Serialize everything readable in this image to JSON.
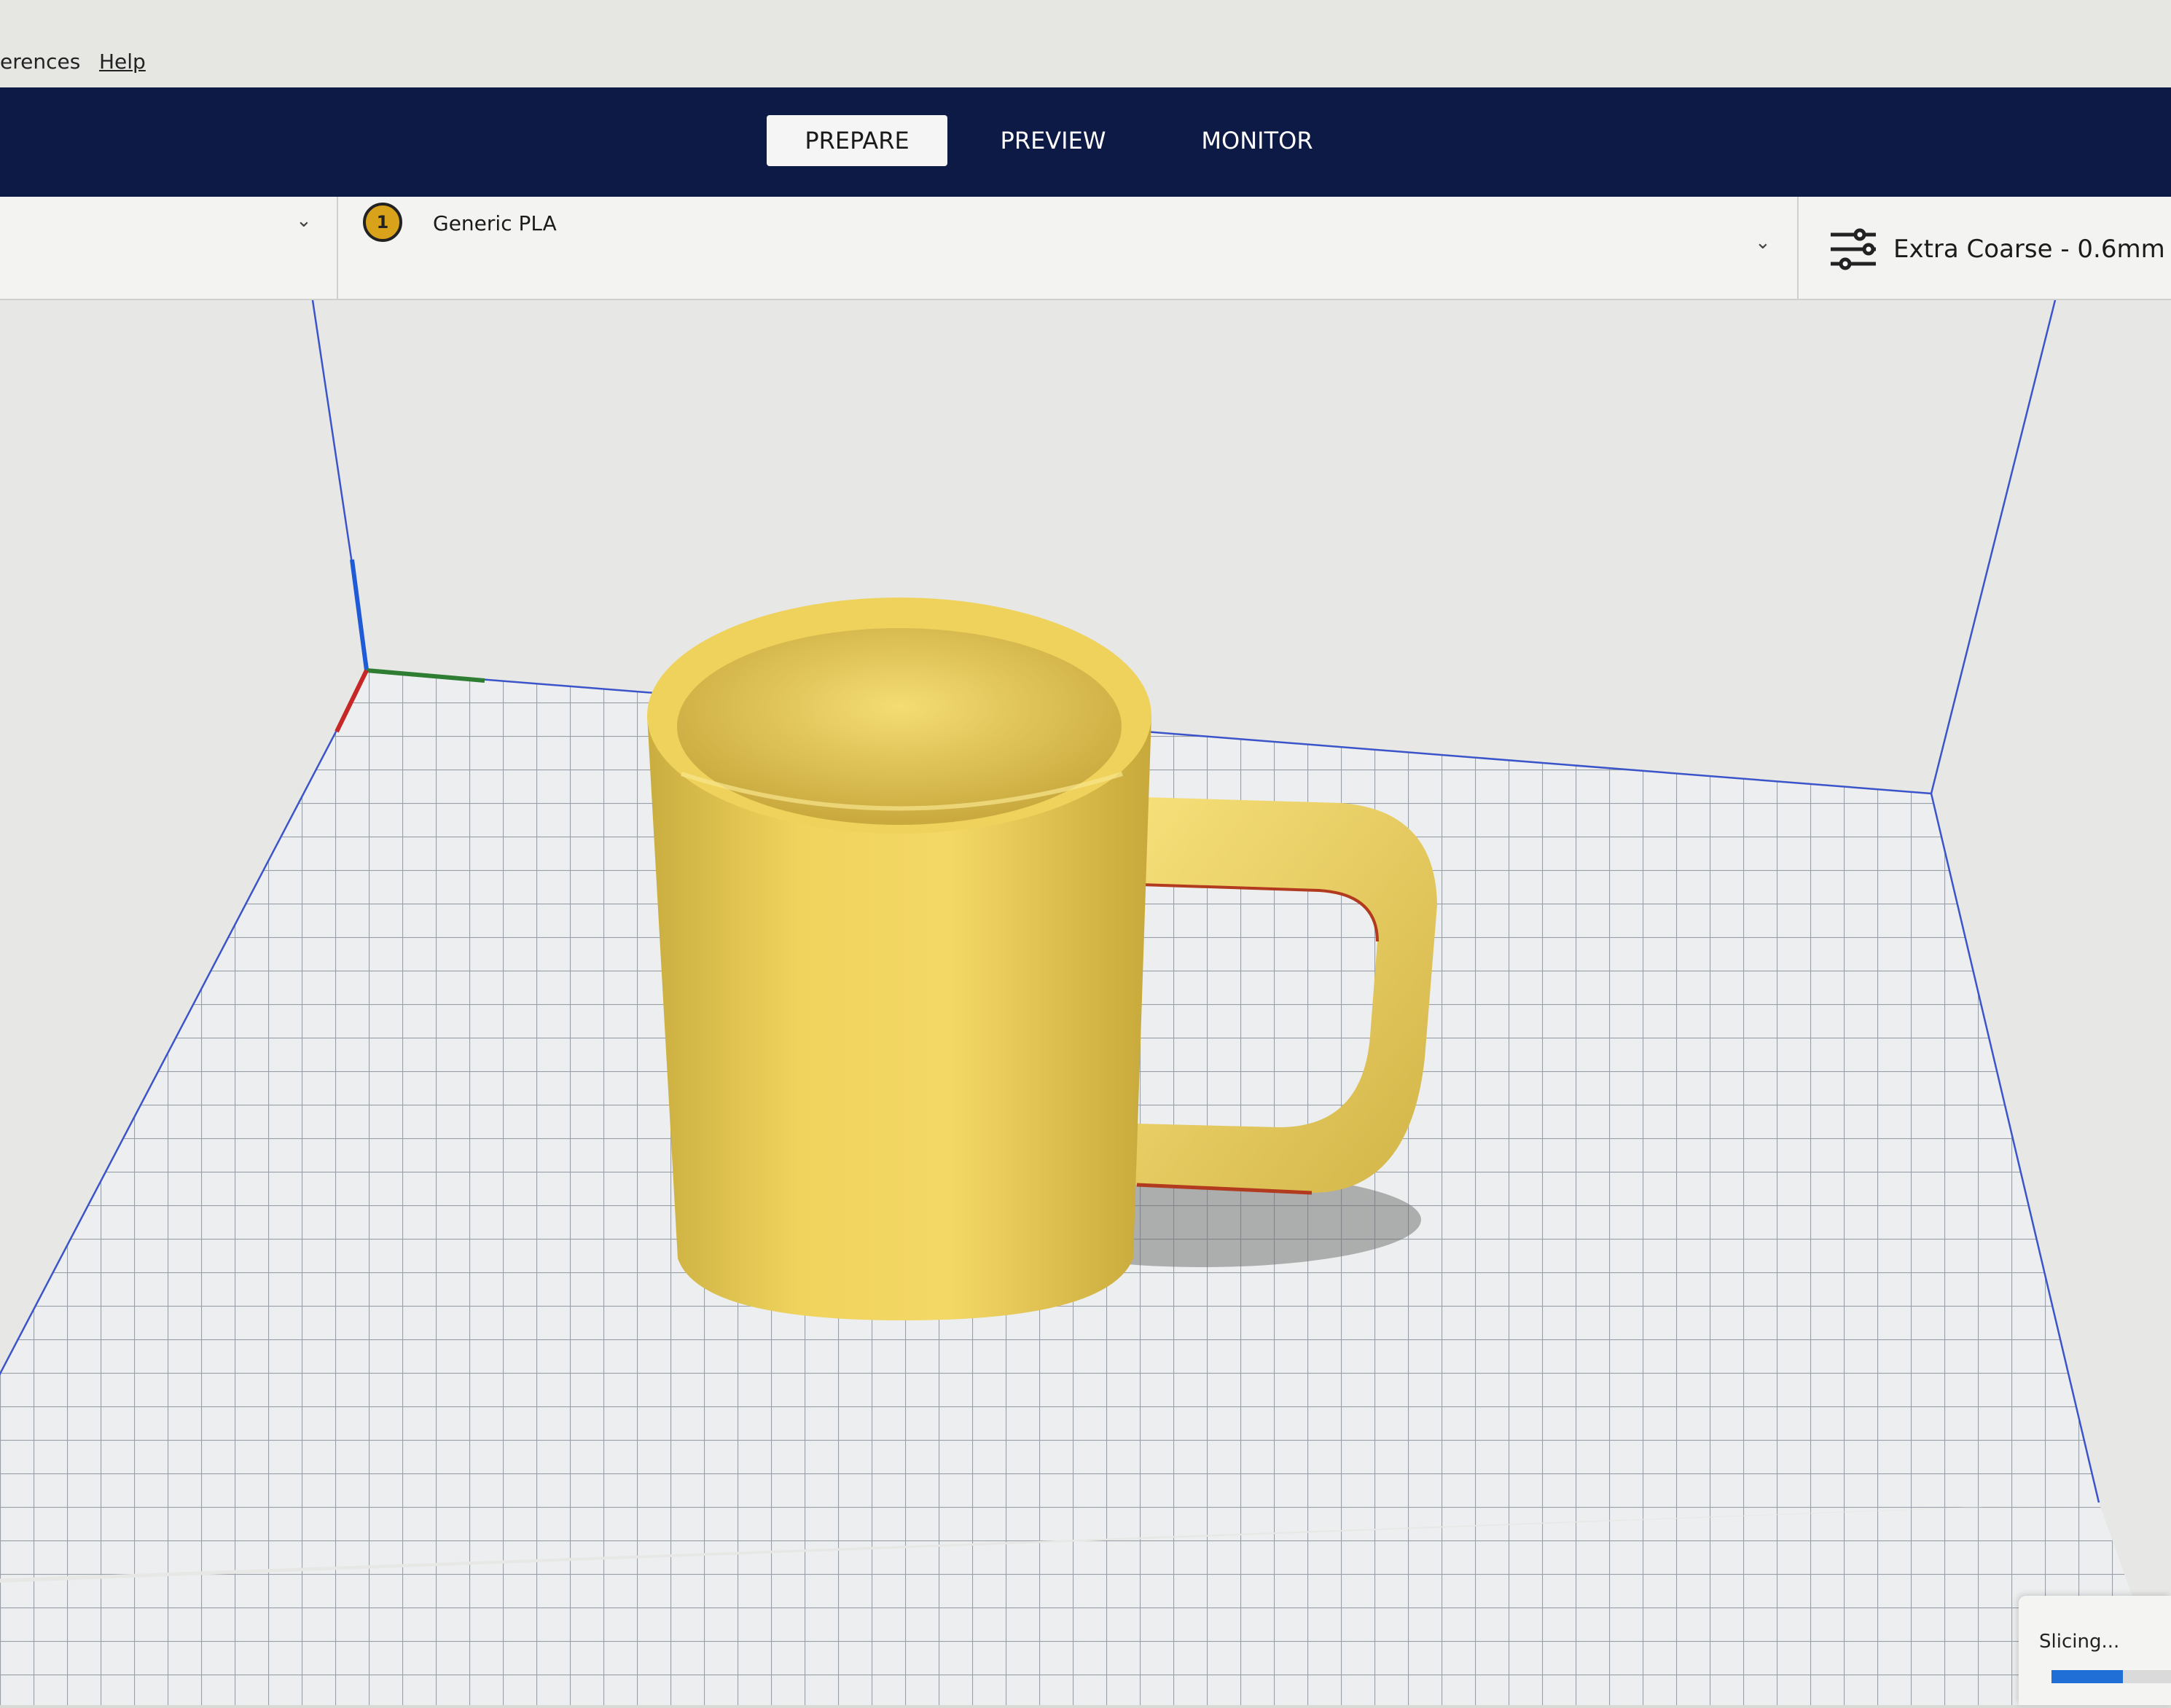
{
  "menu": {
    "items": [
      {
        "label": "erences"
      },
      {
        "label": "Help"
      }
    ]
  },
  "stages": [
    {
      "label": "PREPARE",
      "active": true
    },
    {
      "label": "PREVIEW"
    },
    {
      "label": "MONITOR"
    }
  ],
  "material": {
    "extruder": "1",
    "name": "Generic PLA"
  },
  "profile": {
    "label": "Extra Coarse - 0.6mm"
  },
  "status": {
    "text": "Slicing...",
    "progress": 0.6
  },
  "colors": {
    "accent": "#1f6fd6",
    "navbar": "#0c1a45",
    "model": "#f1d35c",
    "extruder": "#d9a21b"
  },
  "icons": {
    "dropdown": "chevron-down-icon",
    "settings": "sliders-icon"
  }
}
